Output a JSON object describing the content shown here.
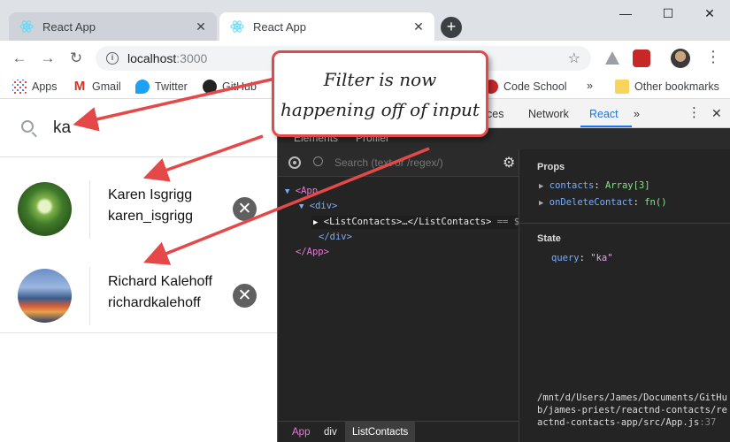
{
  "browser": {
    "tabs": [
      {
        "title": "React App"
      },
      {
        "title": "React App"
      }
    ],
    "address": {
      "host": "localhost",
      "port": ":3000"
    },
    "bookmarks": [
      {
        "label": "Apps"
      },
      {
        "label": "Gmail"
      },
      {
        "label": "Twitter"
      },
      {
        "label": "GitHub"
      },
      {
        "label": "Code School"
      },
      {
        "label": "Other bookmarks"
      }
    ],
    "overflow_label": "»",
    "colors": {
      "accent": "#1a73e8",
      "tabstrip": "#dee1e6"
    }
  },
  "app": {
    "search": {
      "query": "ka"
    },
    "contacts": [
      {
        "name": "Karen Isgrigg",
        "handle": "karen_isgrigg"
      },
      {
        "name": "Richard Kalehoff",
        "handle": "richardkalehoff"
      }
    ]
  },
  "devtools": {
    "tabs": [
      {
        "label": "ces"
      },
      {
        "label": "Network"
      },
      {
        "label": "React"
      },
      {
        "label": "»"
      }
    ],
    "subtabs": [
      {
        "label": "Elements"
      },
      {
        "label": "Profiler"
      }
    ],
    "search_placeholder": "Search (text or /regex/)",
    "tree": {
      "app_open": "<App",
      "div_open": "<div>",
      "list_contacts": "<ListContacts>…</ListContacts>",
      "selected_suffix": "== $r",
      "div_close": "</div>",
      "app_close": "</App>"
    },
    "props": {
      "title": "Props",
      "items": [
        {
          "key": "contacts",
          "value": "Array[3]"
        },
        {
          "key": "onDeleteContact",
          "value": "fn()"
        }
      ]
    },
    "state": {
      "title": "State",
      "items": [
        {
          "key": "query",
          "value": "\"ka\""
        }
      ]
    },
    "source_path": "/mnt/d/Users/James/Documents/GitHub/james-priest/reactnd-contacts/reactnd-contacts-app/src/App.js",
    "source_line": ":37",
    "breadcrumbs": [
      {
        "label": "App"
      },
      {
        "label": "div"
      },
      {
        "label": "ListContacts"
      }
    ]
  },
  "annotation": {
    "line1": "Filter is now",
    "line2": "happening off of input",
    "color": "#e54848"
  }
}
